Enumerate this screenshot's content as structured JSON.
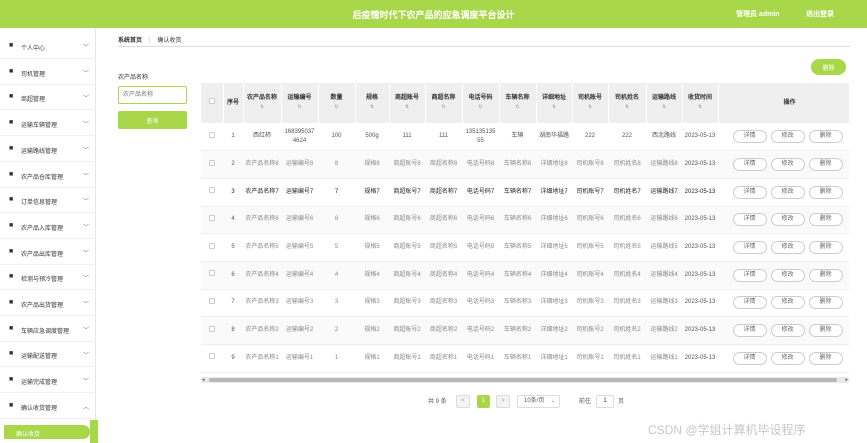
{
  "header": {
    "title": "后疫情时代下农产品的应急调度平台设计",
    "admin_label": "管理员 admin",
    "logout_label": "退出登录"
  },
  "sidebar": {
    "items": [
      {
        "label": "个人中心",
        "icon": "user-icon"
      },
      {
        "label": "司机管理",
        "icon": "driver-icon"
      },
      {
        "label": "商超管理",
        "icon": "store-icon"
      },
      {
        "label": "运输车辆管理",
        "icon": "truck-icon"
      },
      {
        "label": "运输路线管理",
        "icon": "route-icon"
      },
      {
        "label": "农产品仓库管理",
        "icon": "warehouse-icon"
      },
      {
        "label": "订单信息管理",
        "icon": "order-icon"
      },
      {
        "label": "农产品入库管理",
        "icon": "inbound-icon"
      },
      {
        "label": "农产品出库管理",
        "icon": "outbound-icon"
      },
      {
        "label": "检测与预冷管理",
        "icon": "check-icon"
      },
      {
        "label": "农产品出货管理",
        "icon": "shipping-icon"
      },
      {
        "label": "车辆应急调度管理",
        "icon": "dispatch-icon"
      },
      {
        "label": "运输配送管理",
        "icon": "delivery-icon"
      },
      {
        "label": "运输完成管理",
        "icon": "complete-icon"
      },
      {
        "label": "确认收货管理",
        "icon": "receipt-icon"
      }
    ],
    "active_sub": "确认收货"
  },
  "breadcrumb": {
    "home": "系统首页",
    "sep": "⋮",
    "current": "确认收货"
  },
  "filter": {
    "label": "农产品名称",
    "placeholder": "农产品名称",
    "query_button": "查询"
  },
  "toolbar": {
    "delete_label": "删除"
  },
  "table": {
    "columns": [
      "",
      "序号",
      "农产品名称",
      "运输编号",
      "数量",
      "规格",
      "商超账号",
      "商超名称",
      "电话号码",
      "车辆名称",
      "详细地址",
      "司机账号",
      "司机姓名",
      "运输路线",
      "收货时间",
      "操作"
    ],
    "rows": [
      [
        "",
        "1",
        "西红柿",
        "1683950374624",
        "100",
        "500g",
        "111",
        "111",
        "13513513555",
        "车辆",
        "湖南华福路",
        "222",
        "222",
        "西北路线",
        "2023-05-13"
      ],
      [
        "",
        "2",
        "农产品名称8",
        "运输编号8",
        "8",
        "规格8",
        "商超账号8",
        "商超名称8",
        "电话号码8",
        "车辆名称8",
        "详细地址8",
        "司机账号8",
        "司机姓名8",
        "运输路线8",
        "2023-05-13"
      ],
      [
        "",
        "3",
        "农产品名称7",
        "运输编号7",
        "7",
        "规格7",
        "商超账号7",
        "商超名称7",
        "电话号码7",
        "车辆名称7",
        "详细地址7",
        "司机账号7",
        "司机姓名7",
        "运输路线7",
        "2023-05-13"
      ],
      [
        "",
        "4",
        "农产品名称6",
        "运输编号6",
        "6",
        "规格6",
        "商超账号6",
        "商超名称6",
        "电话号码6",
        "车辆名称6",
        "详细地址6",
        "司机账号6",
        "司机姓名6",
        "运输路线6",
        "2023-05-13"
      ],
      [
        "",
        "5",
        "农产品名称5",
        "运输编号5",
        "5",
        "规格5",
        "商超账号5",
        "商超名称5",
        "电话号码5",
        "车辆名称5",
        "详细地址5",
        "司机账号5",
        "司机姓名5",
        "运输路线5",
        "2023-05-13"
      ],
      [
        "",
        "6",
        "农产品名称4",
        "运输编号4",
        "4",
        "规格4",
        "商超账号4",
        "商超名称4",
        "电话号码4",
        "车辆名称4",
        "详细地址4",
        "司机账号4",
        "司机姓名4",
        "运输路线4",
        "2023-05-13"
      ],
      [
        "",
        "7",
        "农产品名称3",
        "运输编号3",
        "3",
        "规格3",
        "商超账号3",
        "商超名称3",
        "电话号码3",
        "车辆名称3",
        "详细地址3",
        "司机账号3",
        "司机姓名3",
        "运输路线3",
        "2023-05-13"
      ],
      [
        "",
        "8",
        "农产品名称2",
        "运输编号2",
        "2",
        "规格2",
        "商超账号2",
        "商超名称2",
        "电话号码2",
        "车辆名称2",
        "详细地址2",
        "司机账号2",
        "司机姓名2",
        "运输路线2",
        "2023-05-13"
      ],
      [
        "",
        "9",
        "农产品名称1",
        "运输编号1",
        "1",
        "规格1",
        "商超账号1",
        "商超名称1",
        "电话号码1",
        "车辆名称1",
        "详细地址1",
        "司机账号1",
        "司机姓名1",
        "运输路线1",
        "2023-05-13"
      ]
    ],
    "actions": [
      "详情",
      "修改",
      "删除"
    ]
  },
  "pagination": {
    "total": "共 9 条",
    "prev": "<",
    "page": "1",
    "next": ">",
    "page_size": "10条/页",
    "goto_label": "前往",
    "goto_value": "1",
    "page_unit": "页"
  },
  "watermark": "CSDN @学姐计算机毕设程序",
  "colors": {
    "accent": "#a8d84a"
  }
}
